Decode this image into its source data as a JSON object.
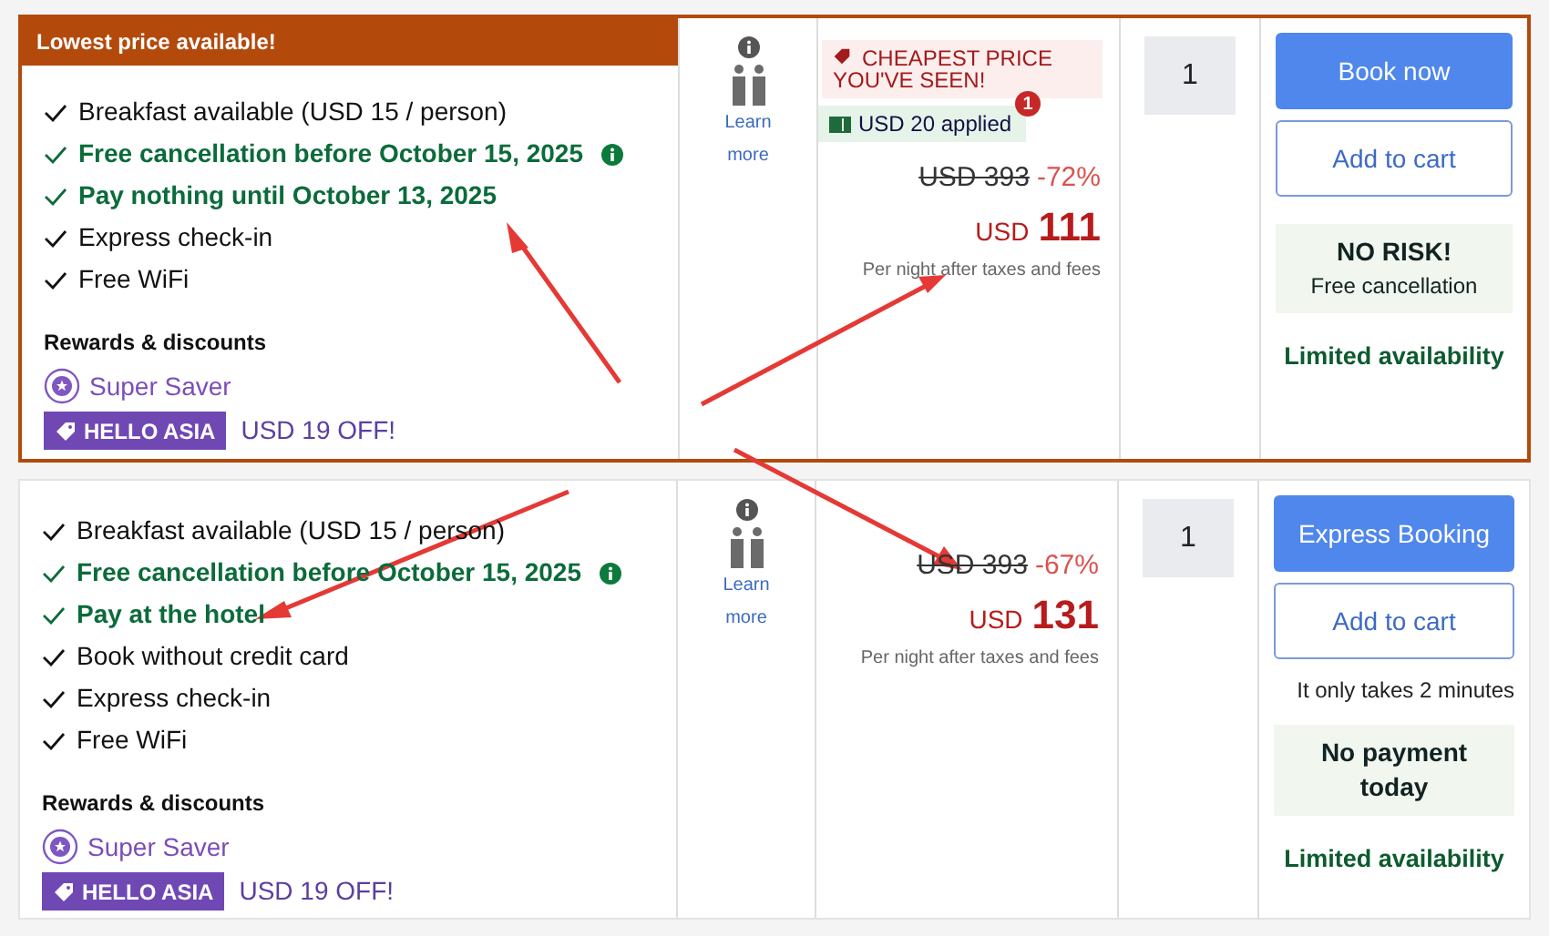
{
  "offers": [
    {
      "header": "Lowest price available!",
      "highlighted": true,
      "features": [
        {
          "text": "Breakfast available (USD 15 / person)",
          "highlight": false,
          "info": false
        },
        {
          "text": "Free cancellation before October 15, 2025",
          "highlight": true,
          "info": true
        },
        {
          "text": "Pay nothing until October 13, 2025",
          "highlight": true,
          "info": false
        },
        {
          "text": "Express check-in",
          "highlight": false,
          "info": false
        },
        {
          "text": "Free WiFi",
          "highlight": false,
          "info": false
        }
      ],
      "rewards_title": "Rewards & discounts",
      "reward": "Super Saver",
      "coupon_code": "HELLO ASIA",
      "coupon_value": "USD 19 OFF!",
      "learn_more": "Learn more",
      "banner": "CHEAPEST PRICE YOU'VE SEEN!",
      "applied": "USD 20 applied",
      "applied_badge": "1",
      "old_price": "USD 393",
      "discount": "-72%",
      "currency": "USD",
      "price": "111",
      "price_note": "Per night after taxes and fees",
      "quantity": "1",
      "primary_button": "Book now",
      "secondary_button": "Add to cart",
      "promo_title": "NO RISK!",
      "promo_subtitle": "Free cancellation",
      "availability": "Limited availability"
    },
    {
      "highlighted": false,
      "features": [
        {
          "text": "Breakfast available (USD 15 / person)",
          "highlight": false,
          "info": false
        },
        {
          "text": "Free cancellation before October 15, 2025",
          "highlight": true,
          "info": true
        },
        {
          "text": "Pay at the hotel",
          "highlight": true,
          "info": false
        },
        {
          "text": "Book without credit card",
          "highlight": false,
          "info": false
        },
        {
          "text": "Express check-in",
          "highlight": false,
          "info": false
        },
        {
          "text": "Free WiFi",
          "highlight": false,
          "info": false
        }
      ],
      "rewards_title": "Rewards & discounts",
      "reward": "Super Saver",
      "coupon_code": "HELLO ASIA",
      "coupon_value": "USD 19 OFF!",
      "learn_more": "Learn more",
      "old_price": "USD 393",
      "discount": "-67%",
      "currency": "USD",
      "price": "131",
      "price_note": "Per night after taxes and fees",
      "quantity": "1",
      "primary_button": "Express Booking",
      "secondary_button": "Add to cart",
      "button_note": "It only takes 2 minutes",
      "promo_title": "No payment today",
      "availability": "Limited availability"
    }
  ]
}
